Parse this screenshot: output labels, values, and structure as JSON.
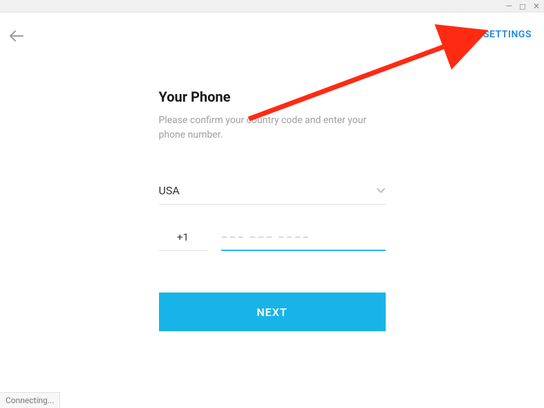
{
  "window": {
    "minimize": "—",
    "maximize": "◻",
    "close": "✕"
  },
  "header": {
    "settings_label": "SETTINGS"
  },
  "form": {
    "title": "Your Phone",
    "subtitle": "Please confirm your country code and enter your phone number.",
    "country": "USA",
    "dial_code": "+1",
    "phone_placeholder": "––– ––– ––––",
    "phone_value": "",
    "next_label": "NEXT"
  },
  "status": {
    "text": "Connecting..."
  },
  "colors": {
    "accent": "#18b4e8",
    "link": "#1e88e5",
    "annotation": "#ff2a12"
  }
}
